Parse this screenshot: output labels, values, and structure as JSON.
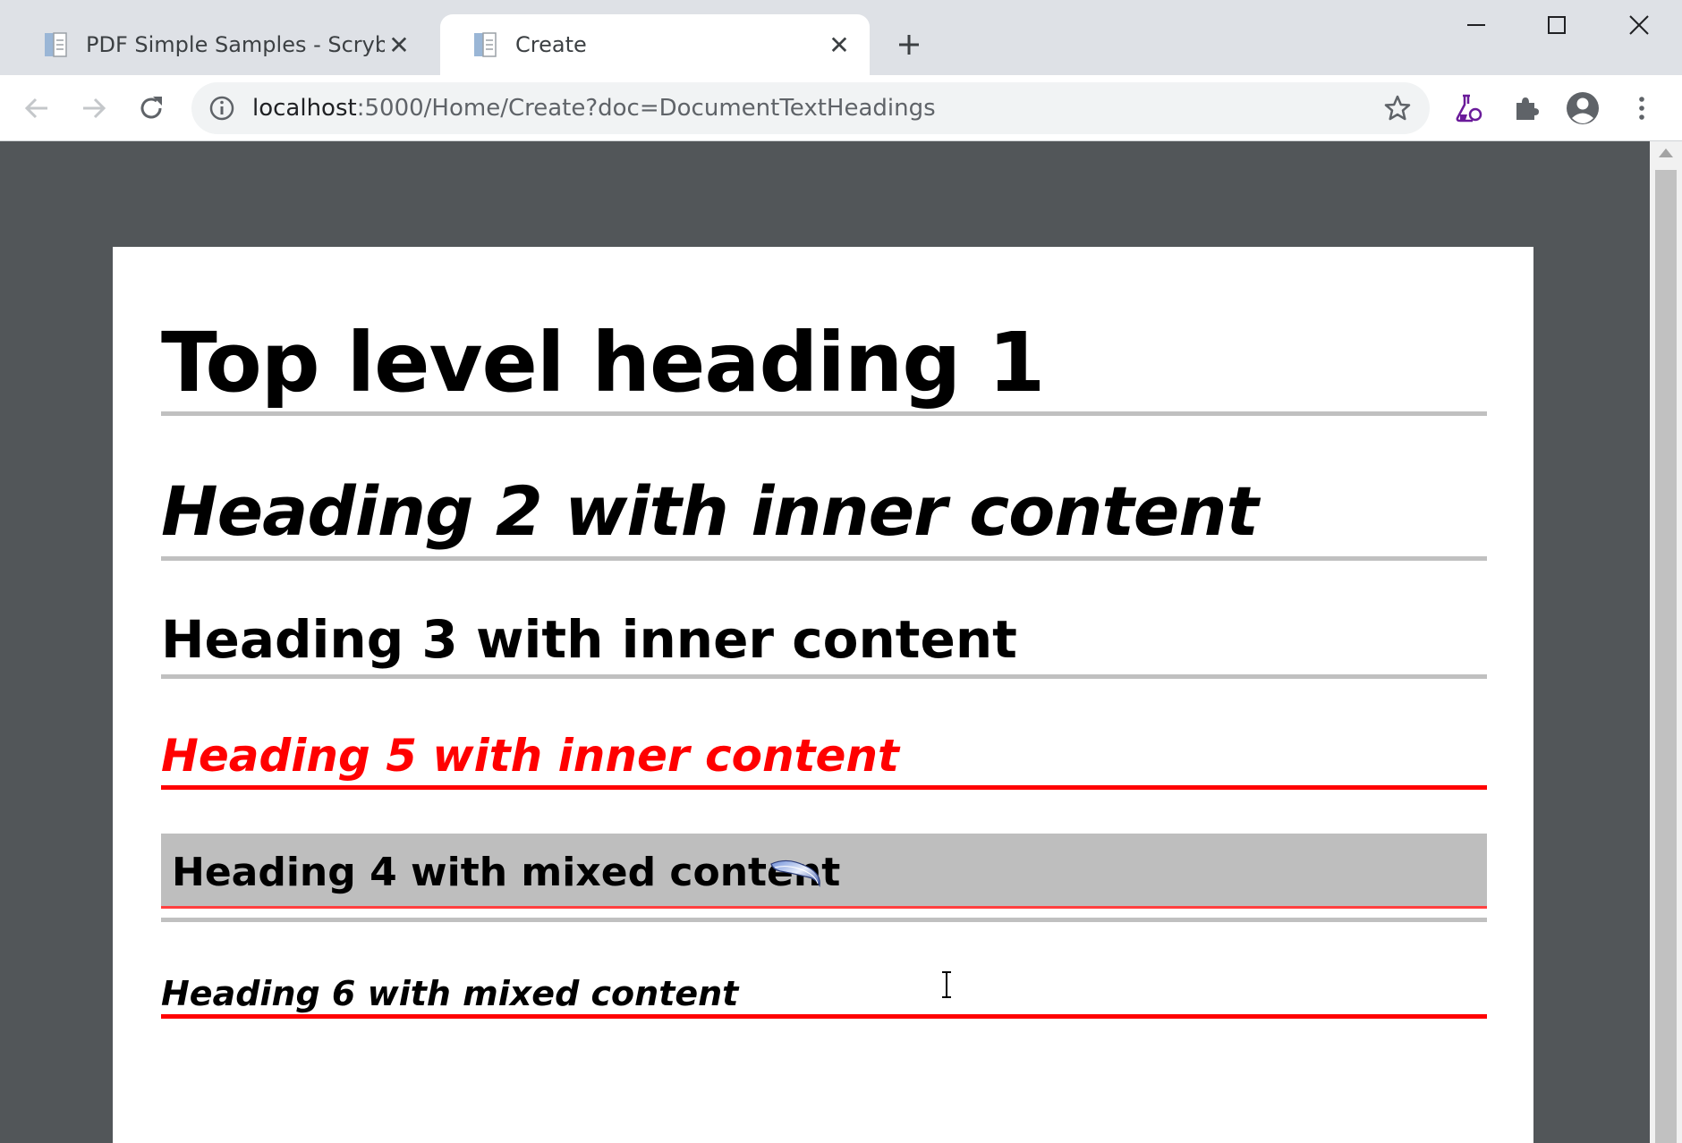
{
  "browser": {
    "tabs": [
      {
        "title": "PDF Simple Samples - Scryber",
        "active": false
      },
      {
        "title": "Create",
        "active": true
      }
    ],
    "new_tab_icon": "plus-icon",
    "url_host": "localhost",
    "url_rest": ":5000/Home/Create?doc=DocumentTextHeadings",
    "icons": [
      "back-arrow-icon",
      "forward-arrow-icon",
      "reload-icon",
      "info-icon",
      "star-icon",
      "labs-flask-icon",
      "extensions-puzzle-icon",
      "profile-avatar-icon",
      "menu-dots-icon"
    ]
  },
  "document": {
    "h1": "Top level heading 1",
    "h2": "Heading 2 with inner content",
    "h3": "Heading 3 with inner content",
    "h5": "Heading 5 with inner content",
    "h4": "Heading 4 with mixed content",
    "h6": "Heading 6 with mixed content"
  },
  "colors": {
    "accent_red": "#ff0000",
    "rule_gray": "#c0c0c0",
    "viewer_bg": "#525659"
  }
}
